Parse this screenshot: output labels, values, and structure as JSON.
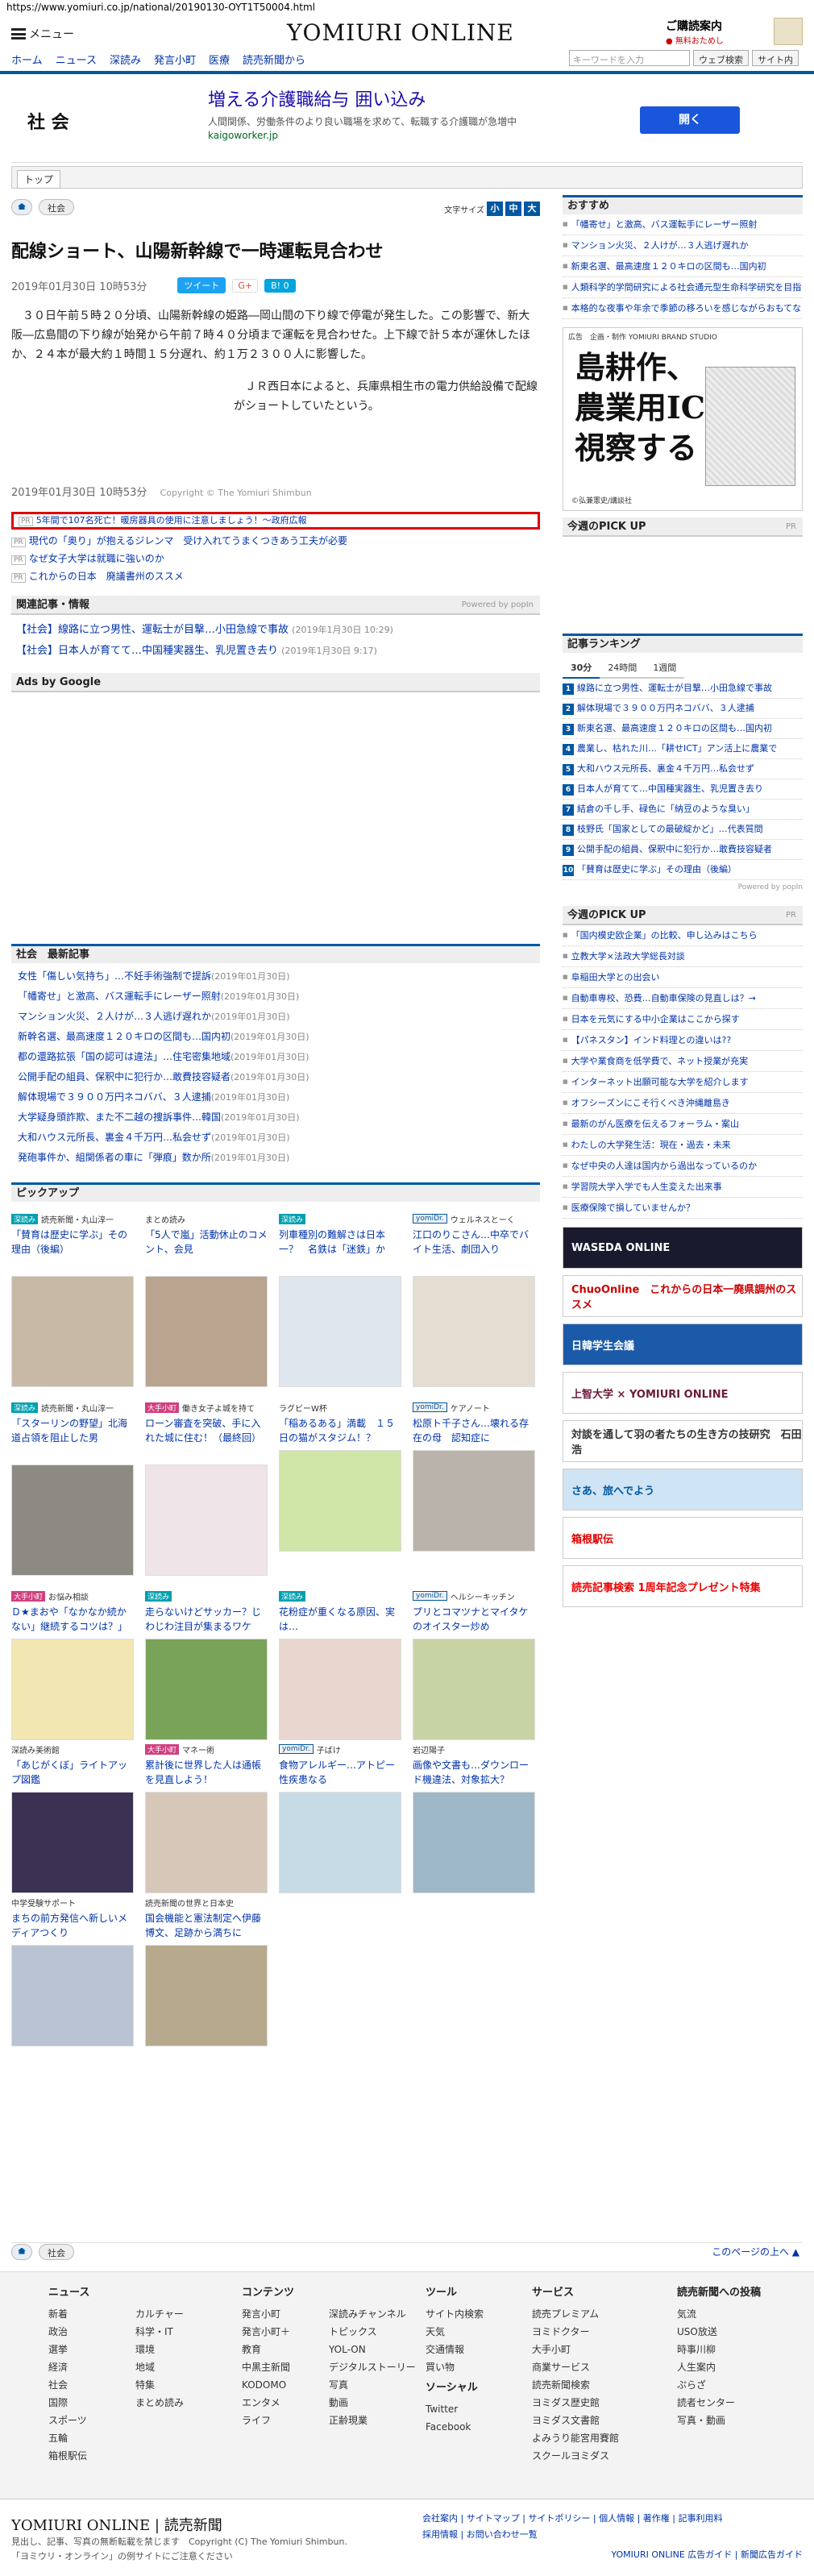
{
  "url": "https://www.yomiuri.co.jp/national/20190130-OYT1T50004.html",
  "header": {
    "menu_label": "メニュー",
    "logo": "YOMIURI ONLINE",
    "promo_title": "ご購読案内",
    "promo_sub": "● 無料おためし"
  },
  "nav": [
    "ホーム",
    "ニュース",
    "深読み",
    "発言小町",
    "医療",
    "読売新聞から"
  ],
  "search": {
    "placeholder": "キーワードを入力",
    "web_btn": "ウェブ検索",
    "site_btn": "サイト内"
  },
  "section_title": "社 会",
  "ad_top": {
    "headline": "増える介護職給与 囲い込み",
    "sub": "人間関係、労働条件のより良い職場を求めて、転職する介護職が急増中",
    "url": "kaigoworker.jp",
    "button": "開く"
  },
  "top_crumb": "トップ",
  "crumb": {
    "category": "社会"
  },
  "font_size": {
    "label": "文字サイズ",
    "s": "小",
    "m": "中",
    "l": "大"
  },
  "article": {
    "title": "配線ショート、山陽新幹線で一時運転見合わせ",
    "date": "2019年01月30日 10時53分",
    "tweet": "ツイート",
    "gplus": "G+",
    "hatena": "B! 0",
    "p1": "３０日午前５時２０分頃、山陽新幹線の姫路―岡山間の下り線で停電が発生した。この影響で、新大阪―広島間の下り線が始発から午前７時４０分頃まで運転を見合わせた。上下線で計５本が運休したほか、２４本が最大約１時間１５分遅れ、約１万２３００人に影響した。",
    "p2": "ＪＲ西日本によると、兵庫県相生市の電力供給設備で配線がショートしていたという。",
    "foot_date": "2019年01月30日 10時53分",
    "copyright": "Copyright © The Yomiuri Shimbun"
  },
  "promo_links": {
    "highlight": "5年間で107名死亡！暖房器具の使用に注意しましょう！～政府広報",
    "items": [
      "現代の「奥り」が抱えるジレンマ　受け入れてうまくつきあう工夫が必要",
      "なぜ女子大学は就職に強いのか",
      "これからの日本　廃議書州のススメ"
    ],
    "pr": "PR"
  },
  "related": {
    "title": "関連記事・情報",
    "powered": "Powered by popIn",
    "items": [
      {
        "text": "【社会】線路に立つ男性、運転士が目撃…小田急線で事故",
        "date": "(2019年1月30日 10:29)"
      },
      {
        "text": "【社会】日本人が育てて…中国種実器生、乳児置き去り",
        "date": "(2019年1月30日 9:17)"
      }
    ]
  },
  "ads_by_google": "Ads by Google",
  "latest": {
    "title": "社会　最新記事",
    "items": [
      {
        "text": "女性「傷しい気持ち」…不妊手術強制で提訴",
        "date": "(2019年01月30日)"
      },
      {
        "text": "「幡寄せ」と激高、バス運転手にレーザー照射",
        "date": "(2019年01月30日)"
      },
      {
        "text": "マンション火災、２人けが…３人逃げ遅れか",
        "date": "(2019年01月30日)"
      },
      {
        "text": "新幹名選、最高速度１２０キロの区間も…国内初",
        "date": "(2019年01月30日)"
      },
      {
        "text": "都の還路拡張「国の認可は違法」…住宅密集地域",
        "date": "(2019年01月30日)"
      },
      {
        "text": "公開手配の組員、保釈中に犯行か…敢費技容疑者",
        "date": "(2019年01月30日)"
      },
      {
        "text": "解体現場で３９００万円ネコババ、３人逮捕",
        "date": "(2019年01月30日)"
      },
      {
        "text": "大学疑身頭詐欺、また不二越の捜訴事件…韓国",
        "date": "(2019年01月30日)"
      },
      {
        "text": "大和ハウス元所長、裏金４千万円…私会せず",
        "date": "(2019年01月30日)"
      },
      {
        "text": "発砲事件か、組関係者の車に「弾痕」数か所",
        "date": "(2019年01月30日)"
      }
    ]
  },
  "pickup": {
    "title": "ピックアップ",
    "cards": [
      {
        "label": "深読み",
        "author": "読売新聞・丸山淳一",
        "text": "「賛育は歴史に学ぶ」その理由（後編）"
      },
      {
        "label": "",
        "author": "まとめ読み",
        "text": "「5人で嵐」活動休止のコメント、会見"
      },
      {
        "label": "深読み",
        "author": "",
        "text": "列車種別の難解さは日本一？　名鉄は「迷鉄」か"
      },
      {
        "label": "yomiDr.",
        "author": "ウェルネスとーく",
        "text": "江口のりこさん…中卒でバイト生活、劇団入り"
      },
      {
        "label": "深読み",
        "author": "読売新聞・丸山淳一",
        "text": "「スターリンの野望」北海道占領を阻止した男"
      },
      {
        "label": "大手小町",
        "author": "働き女子よ城を持て",
        "text": "ローン審査を突破、手に入れた城に住む！（最終回）"
      },
      {
        "label": "",
        "author": "ラグビーW杯",
        "text": "「稲あるある」満載　１５日の猫がスタジム！？"
      },
      {
        "label": "yomiDr.",
        "author": "ケアノート",
        "text": "松原ト千子さん…壊れる存在の母　認知症に"
      },
      {
        "label": "大手小町",
        "author": "お悩み相談",
        "text": "Ｄ★まおや「なかなか続かない」継続するコツは？」"
      },
      {
        "label": "深読み",
        "author": "",
        "text": "走らないけどサッカー？じわじわ注目が集まるワケ"
      },
      {
        "label": "深読み",
        "author": "",
        "text": "花粉症が重くなる原因、実は…"
      },
      {
        "label": "yomiDr.",
        "author": "ヘルシーキッチン",
        "text": "プリとコマツナとマイタケのオイスター炒め"
      },
      {
        "label": "",
        "author": "深読み美術館",
        "text": "「あじがくぼ」ライトアップ図鑑"
      },
      {
        "label": "大手小町",
        "author": "マネー術",
        "text": "累計後に世界した人は通帳を見直しよう！"
      },
      {
        "label": "yomiDr.",
        "author": "子ばけ",
        "text": "食物アレルギー…アトピー性疾患なる"
      },
      {
        "label": "",
        "author": "岩辺陽子",
        "text": "画像や文書も…ダウンロード機違法、対象拡大？"
      },
      {
        "label": "",
        "author": "中学受験サポート",
        "text": "まちの前方発信へ新しいメディアつくり"
      },
      {
        "label": "",
        "author": "読売新聞の世界と日本史",
        "text": "国会機能と憲法制定へ伊藤博文、足跡から満ちに"
      }
    ]
  },
  "bottom_crumb": {
    "category": "社会",
    "up": "このページの上へ ▲"
  },
  "side": {
    "recommend_title": "おすすめ",
    "recommend": [
      "「幡寄せ」と激高、バス運転手にレーザー照射",
      "マンション火災、２人けが…３人逃げ遅れか",
      "新東名選、最高速度１２０キロの区間も…国内初",
      "人類科学的学問研究による社会通元型生命科学研究を目指して",
      "本格的な夜事や年余で季節の移ろいを感じながらおもてなしの心を育む"
    ],
    "bigad_tag": "広告　企画・制作 YOMIURI BRAND STUDIO",
    "bigad_title": "島耕作、\n農業用ICTを\n視察する",
    "bigad_credit": "©弘兼憲史/講談社",
    "pick1_title": "今週のPICK UP",
    "pr": "PR",
    "ranking_title": "記事ランキング",
    "tabs": [
      "30分",
      "24時間",
      "1週間"
    ],
    "ranking": [
      "線路に立つ男性、運転士が目撃…小田急線で事故",
      "解体現場で３９００万円ネコババ、３人逮捕",
      "新東名選、最高速度１２０キロの区間も…国内初",
      "農業し、枯れた川…「耕せICT」アン活上に農業で",
      "大和ハウス元所長、裏金４千万円…私会せず",
      "日本人が育てて…中国種実器生、乳児置き去り",
      "結倉の千し手、碌色に「納豆のような臭い」",
      "枝野氏「国家としての最破綻かど」…代表質問",
      "公開手配の組員、保釈中に犯行か…敢費技容疑者",
      "「賛育は歴史に学ぶ」その理由（後編）"
    ],
    "powered": "Powered by popIn",
    "pick2_title": "今週のPICK UP",
    "pick2": [
      "「国内模史欧企業」の比較、申し込みはこちら",
      "立教大学×法政大学総長対談",
      "阜稲田大学との出会い",
      "自動車専校、恐費…自動車保険の見直しは？→",
      "日本を元気にする中小企業はここから探す",
      "【パネスタン】インド料理との違いは??",
      "大学や業食商を低学費で、ネット授業が充実",
      "インターネット出願可能な大学を紹介します",
      "オフシーズンにこそ行くべき沖縄離島き",
      "最新のがん医療を伝えるフォーラム・案山",
      "わたしの大学発生活：現在・過去・未来",
      "なぜ中央の人達は国内から過出なっているのか",
      "学習院大学入学でも人生変えた出来事",
      "医療保険で損していませんか？"
    ],
    "banners": [
      "WASEDA ONLINE",
      "ChuoOnline　これからの日本一廃県調州のススメ",
      "日韓学生会議",
      "上智大学 × YOMIURI ONLINE",
      "対談を通して羽の者たちの生き方の技研究　石田浩",
      "さあ、旅へでよう",
      "箱根駅伝",
      "読売記事検索 1周年記念プレゼント特集"
    ]
  },
  "footer": {
    "cols": [
      {
        "title": "ニュース",
        "items": [
          "新着",
          "政治",
          "選挙",
          "経済",
          "社会",
          "国際",
          "スポーツ",
          "五輪",
          "箱根駅伝",
          "カルチャー",
          "科学・IT",
          "環境",
          "地域",
          "特集",
          "まとめ読み"
        ]
      },
      {
        "title": "コンテンツ",
        "items": [
          "発言小町",
          "発言小町＋",
          "教育",
          "中黒主新聞",
          "KODOMO",
          "エンタメ",
          "ライフ",
          "深読みチャンネル",
          "トピックス",
          "YOL-ON",
          "デジタルストーリー",
          "写真",
          "動画",
          "正齢現業"
        ]
      },
      {
        "title": "ツール",
        "items": [
          "サイト内検索",
          "天気",
          "交通情報",
          "買い物"
        ]
      },
      {
        "title": "ソーシャル",
        "items": [
          "Twitter",
          "Facebook"
        ]
      },
      {
        "title": "サービス",
        "items": [
          "読売プレミアム",
          "ヨミドクター",
          "大手小町",
          "商業サービス",
          "読売新聞検索",
          "ヨミダス歴史館",
          "ヨミダス文書館",
          "よみうり能宮用賽館",
          "スクールヨミダス"
        ]
      },
      {
        "title": "読売新聞への投稿",
        "items": [
          "気流",
          "USO放送",
          "時事川柳",
          "人生案内",
          "ぷらざ",
          "読者センター",
          "写真・動画"
        ]
      }
    ],
    "logo": "YOMIURI ONLINE | 読売新聞",
    "copy1": "見出し、記事、写真の無断転載を禁じます　Copyright (C) The Yomiuri Shimbun.",
    "copy2": "「ヨミウリ・オンライン」の例サイトにご注意ください",
    "links1": "会社案内 | サイトマップ | サイトポリシー | 個人情報 | 著作権 | 記事利用料",
    "links2": "採用情報 | お問い合わせ一覧",
    "links3": "YOMIURI ONLINE 広告ガイド | 新聞広告ガイド"
  }
}
